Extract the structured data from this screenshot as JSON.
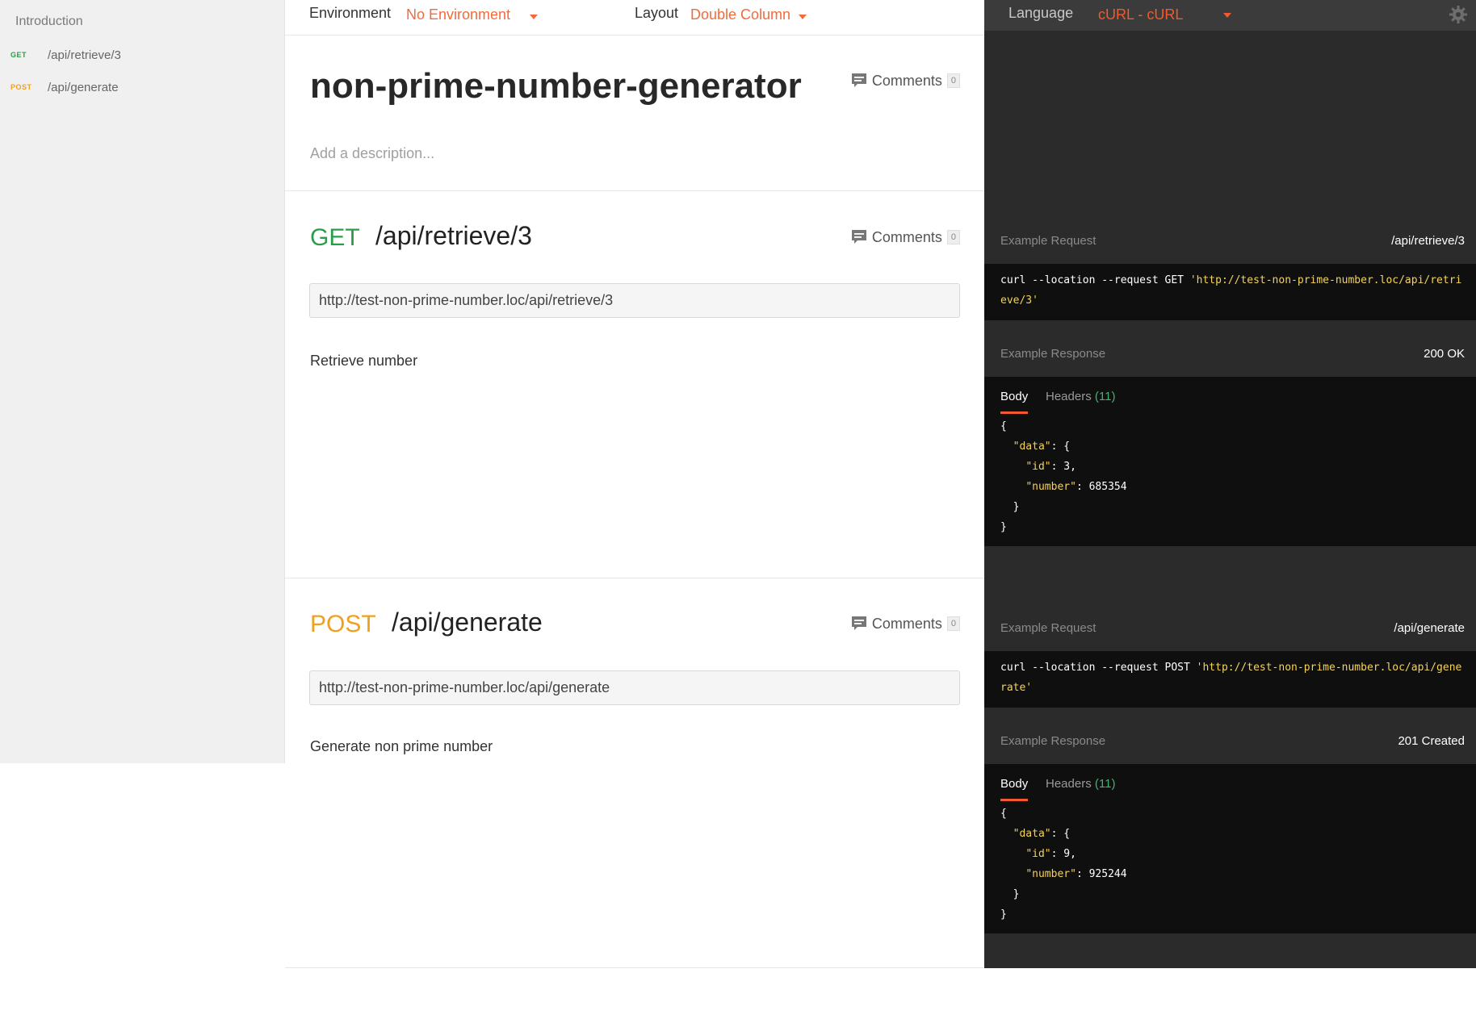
{
  "sidebar": {
    "intro": "Introduction",
    "items": [
      {
        "method": "GET",
        "path": "/api/retrieve/3",
        "color": "#2a9d4a"
      },
      {
        "method": "POST",
        "path": "/api/generate",
        "color": "#f0a020"
      }
    ]
  },
  "topbar": {
    "environment_label": "Environment",
    "environment_value": "No Environment",
    "layout_label": "Layout",
    "layout_value": "Double Column"
  },
  "collection": {
    "title": "non-prime-number-generator",
    "comments_label": "Comments",
    "comments_count": "0",
    "description_placeholder": "Add a description..."
  },
  "requests": [
    {
      "method": "GET",
      "method_color": "#2a9d4a",
      "path": "/api/retrieve/3",
      "comments_label": "Comments",
      "comments_count": "0",
      "url": "http://test-non-prime-number.loc/api/retrieve/3",
      "description": "Retrieve number"
    },
    {
      "method": "POST",
      "method_color": "#f0a020",
      "path": "/api/generate",
      "comments_label": "Comments",
      "comments_count": "0",
      "url": "http://test-non-prime-number.loc/api/generate",
      "description": "Generate non prime number"
    }
  ],
  "right": {
    "language_label": "Language",
    "language_value": "cURL - cURL",
    "examples": [
      {
        "request_label": "Example Request",
        "request_path": "/api/retrieve/3",
        "curl_prefix": "curl --location --request GET ",
        "curl_url": "'http://test-non-prime-number.loc/api/retrieve/3'",
        "response_label": "Example Response",
        "response_status": "200 OK",
        "tab_body": "Body",
        "tab_headers": "Headers",
        "headers_count": "(11)",
        "json_id": "3",
        "json_number": "685354"
      },
      {
        "request_label": "Example Request",
        "request_path": "/api/generate",
        "curl_prefix": "curl --location --request POST ",
        "curl_url": "'http://test-non-prime-number.loc/api/generate'",
        "response_label": "Example Response",
        "response_status": "201 Created",
        "tab_body": "Body",
        "tab_headers": "Headers",
        "headers_count": "(11)",
        "json_id": "9",
        "json_number": "925244"
      }
    ],
    "json_keys": {
      "data": "\"data\"",
      "id": "\"id\"",
      "number": "\"number\""
    }
  }
}
